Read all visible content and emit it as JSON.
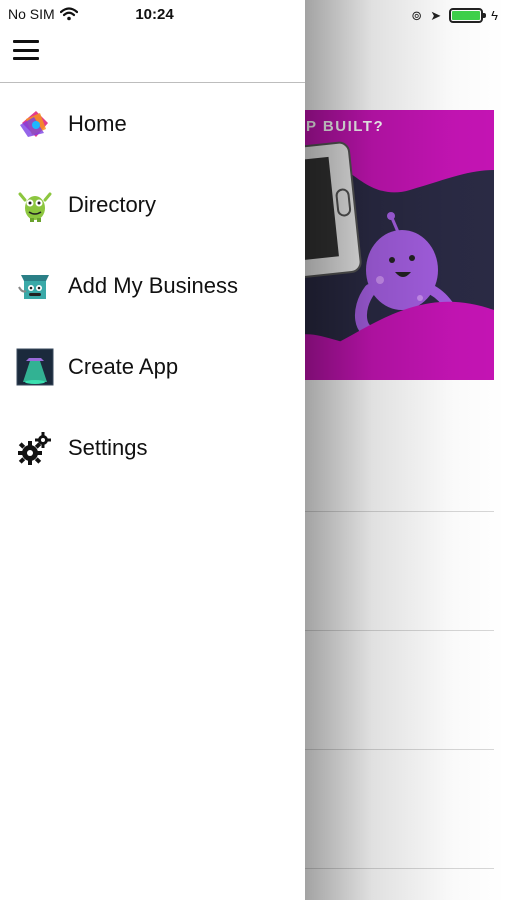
{
  "status_bar": {
    "carrier": "No SIM",
    "time": "10:24",
    "battery_level": 1.0,
    "battery_color": "#3fd24b"
  },
  "drawer": {
    "menu_items": [
      {
        "label": "Home",
        "icon": "home-icon"
      },
      {
        "label": "Directory",
        "icon": "directory-icon"
      },
      {
        "label": "Add My Business",
        "icon": "add-business-icon"
      },
      {
        "label": "Create App",
        "icon": "create-app-icon"
      },
      {
        "label": "Settings",
        "icon": "settings-icon"
      }
    ]
  },
  "background": {
    "banner_text": "P BUILT?",
    "banner_color": "#c414b4"
  }
}
